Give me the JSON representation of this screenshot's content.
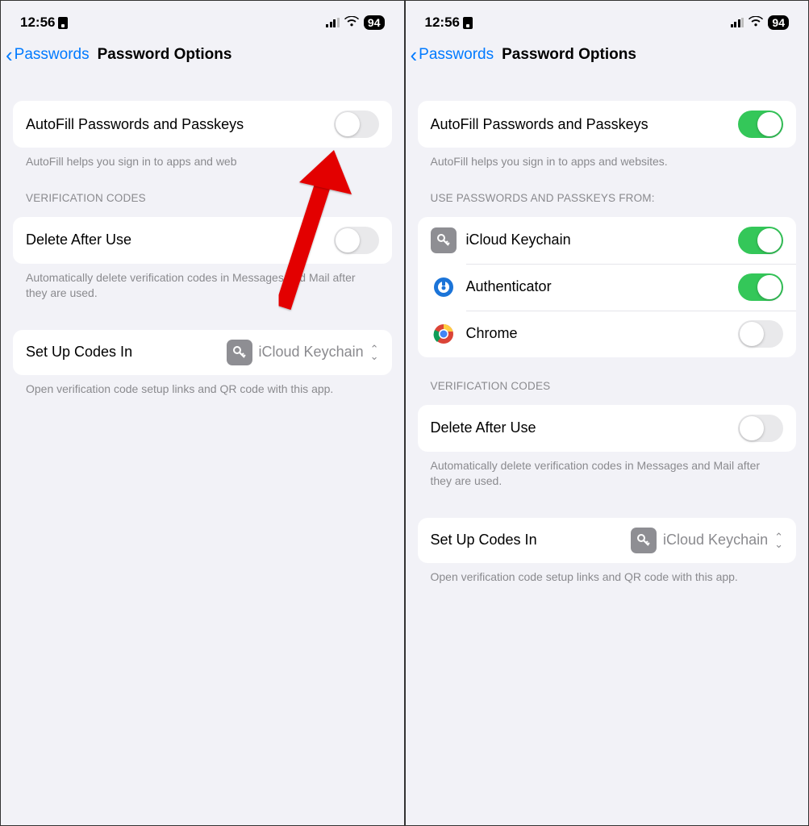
{
  "status": {
    "time": "12:56",
    "battery": "94"
  },
  "nav": {
    "back_label": "Passwords",
    "title": "Password Options"
  },
  "autofill": {
    "title": "AutoFill Passwords and Passkeys",
    "footer": "AutoFill helps you sign in to apps and websites.",
    "footer_clipped": "AutoFill helps you sign in to apps and web"
  },
  "providers": {
    "header": "USE PASSWORDS AND PASSKEYS FROM:",
    "items": [
      {
        "label": "iCloud Keychain",
        "on": true,
        "icon": "key"
      },
      {
        "label": "Authenticator",
        "on": true,
        "icon": "authenticator"
      },
      {
        "label": "Chrome",
        "on": false,
        "icon": "chrome"
      }
    ]
  },
  "verification": {
    "header": "VERIFICATION CODES",
    "delete_label": "Delete After Use",
    "delete_footer": "Automatically delete verification codes in Messages and Mail after they are used."
  },
  "setup": {
    "label": "Set Up Codes In",
    "value": "iCloud Keychain",
    "footer": "Open verification code setup links and QR code with this app."
  }
}
